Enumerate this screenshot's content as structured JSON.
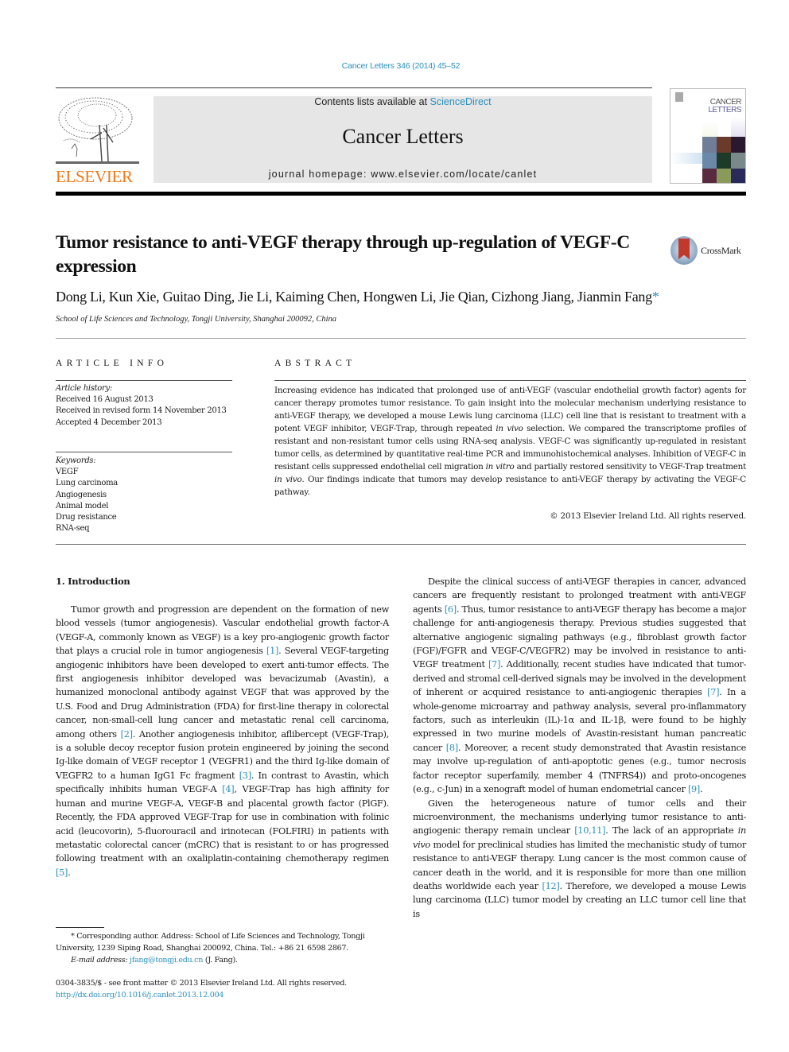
{
  "header": {
    "citation": "Cancer Letters 346 (2014) 45–52",
    "contents_prefix": "Contents lists available at ",
    "contents_link": "ScienceDirect",
    "journal_title": "Cancer Letters",
    "homepage": "journal homepage: www.elsevier.com/locate/canlet",
    "publisher_wordmark": "ELSEVIER",
    "cover_title_line1": "CANCER",
    "cover_title_line2": "LETTERS",
    "brand_color": "#f07a1a",
    "link_color": "#2a8fbd"
  },
  "article": {
    "title": "Tumor resistance to anti-VEGF therapy through up-regulation of VEGF-C expression",
    "crossmark_label": "CrossMark",
    "authors": "Dong Li, Kun Xie, Guitao Ding, Jie Li, Kaiming Chen, Hongwen Li, Jie Qian, Cizhong Jiang, Jianmin Fang",
    "corresponding_marker": "*",
    "affiliation": "School of Life Sciences and Technology, Tongji University, Shanghai 200092, China"
  },
  "article_info": {
    "heading": "ARTICLE INFO",
    "history_label": "Article history:",
    "history": [
      "Received 16 August 2013",
      "Received in revised form 14 November 2013",
      "Accepted 4 December 2013"
    ],
    "keywords_label": "Keywords:",
    "keywords": [
      "VEGF",
      "Lung carcinoma",
      "Angiogenesis",
      "Animal model",
      "Drug resistance",
      "RNA-seq"
    ]
  },
  "abstract": {
    "heading": "ABSTRACT",
    "seg1": "Increasing evidence has indicated that prolonged use of anti-VEGF (vascular endothelial growth factor) agents for cancer therapy promotes tumor resistance. To gain insight into the molecular mechanism underlying resistance to anti-VEGF therapy, we developed a mouse Lewis lung carcinoma (LLC) cell line that is resistant to treatment with a potent VEGF inhibitor, VEGF-Trap, through repeated ",
    "ital1": "in vivo",
    "seg2": " selection. We compared the transcriptome profiles of resistant and non-resistant tumor cells using RNA-seq analysis. VEGF-C was significantly up-regulated in resistant tumor cells, as determined by quantitative real-time PCR and immunohistochemical analyses. Inhibition of VEGF-C in resistant cells suppressed endothelial cell migration ",
    "ital2": "in vitro",
    "seg3": " and partially restored sensitivity to VEGF-Trap treatment ",
    "ital3": "in vivo",
    "seg4": ". Our findings indicate that tumors may develop resistance to anti-VEGF therapy by activating the VEGF-C pathway.",
    "copyright": "© 2013 Elsevier Ireland Ltd. All rights reserved."
  },
  "body": {
    "section_heading": "1. Introduction",
    "left_p1": {
      "t1": "Tumor growth and progression are dependent on the formation of new blood vessels (tumor angiogenesis). Vascular endothelial growth factor-A (VEGF-A, commonly known as VEGF) is a key pro-angiogenic growth factor that plays a crucial role in tumor angiogenesis ",
      "r1": "[1]",
      "t2": ". Several VEGF-targeting angiogenic inhibitors have been developed to exert anti-tumor effects. The first angiogenesis inhibitor developed was bevacizumab (Avastin), a humanized monoclonal antibody against VEGF that was approved by the U.S. Food and Drug Administration (FDA) for first-line therapy in colorectal cancer, non-small-cell lung cancer and metastatic renal cell carcinoma, among others ",
      "r2": "[2]",
      "t3": ". Another angiogenesis inhibitor, aflibercept (VEGF-Trap), is a soluble decoy receptor fusion protein engineered by joining the second Ig-like domain of VEGF receptor 1 (VEGFR1) and the third Ig-like domain of VEGFR2 to a human IgG1 Fc fragment ",
      "r3": "[3]",
      "t4": ". In contrast to Avastin, which specifically inhibits human VEGF-A ",
      "r4": "[4]",
      "t5": ", VEGF-Trap has high affinity for human and murine VEGF-A, VEGF-B and placental growth factor (PlGF). Recently, the FDA approved VEGF-Trap for use in combination with folinic acid (leucovorin), 5-fluorouracil and irinotecan (FOLFIRI) in patients with metastatic colorectal cancer (mCRC) that is resistant to or has progressed following treatment with an oxaliplatin-containing chemotherapy regimen ",
      "r5": "[5]",
      "t6": "."
    },
    "right_p1": {
      "t1": "Despite the clinical success of anti-VEGF therapies in cancer, advanced cancers are frequently resistant to prolonged treatment with anti-VEGF agents ",
      "r1": "[6]",
      "t2": ". Thus, tumor resistance to anti-VEGF therapy has become a major challenge for anti-angiogenesis therapy. Previous studies suggested that alternative angiogenic signaling pathways (e.g., fibroblast growth factor (FGF)/FGFR and VEGF-C/VEGFR2) may be involved in resistance to anti-VEGF treatment ",
      "r2": "[7]",
      "t3": ". Additionally, recent studies have indicated that tumor-derived and stromal cell-derived signals may be involved in the development of inherent or acquired resistance to anti-angiogenic therapies ",
      "r3": "[7]",
      "t4": ". In a whole-genome microarray and pathway analysis, several pro-inflammatory factors, such as interleukin (IL)-1α and IL-1β, were found to be highly expressed in two murine models of Avastin-resistant human pancreatic cancer ",
      "r4": "[8]",
      "t5": ". Moreover, a recent study demonstrated that Avastin resistance may involve up-regulation of anti-apoptotic genes (e.g., tumor necrosis factor receptor superfamily, member 4 (TNFRS4)) and proto-oncogenes (e.g., c-Jun) in a xenograft model of human endometrial cancer ",
      "r5": "[9]",
      "t6": "."
    },
    "right_p2": {
      "t1": "Given the heterogeneous nature of tumor cells and their microenvironment, the mechanisms underlying tumor resistance to anti-angiogenic therapy remain unclear ",
      "r1": "[10,11]",
      "t2": ". The lack of an appropriate ",
      "i1": "in vivo",
      "t3": " model for preclinical studies has limited the mechanistic study of tumor resistance to anti-VEGF therapy. Lung cancer is the most common cause of cancer death in the world, and it is responsible for more than one million deaths worldwide each year ",
      "r2": "[12]",
      "t4": ". Therefore, we developed a mouse Lewis lung carcinoma (LLC) tumor model by creating an LLC tumor cell line that is"
    }
  },
  "footnotes": {
    "corresponding": "* Corresponding author. Address: School of Life Sciences and Technology, Tongji University, 1239 Siping Road, Shanghai 200092, China. Tel.: +86 21 6598 2867.",
    "email_label": "E-mail address:",
    "email": "jfang@tongji.edu.cn",
    "email_suffix": " (J. Fang).",
    "issn_line": "0304-3835/$ - see front matter © 2013 Elsevier Ireland Ltd. All rights reserved.",
    "doi": "http://dx.doi.org/10.1016/j.canlet.2013.12.004"
  }
}
